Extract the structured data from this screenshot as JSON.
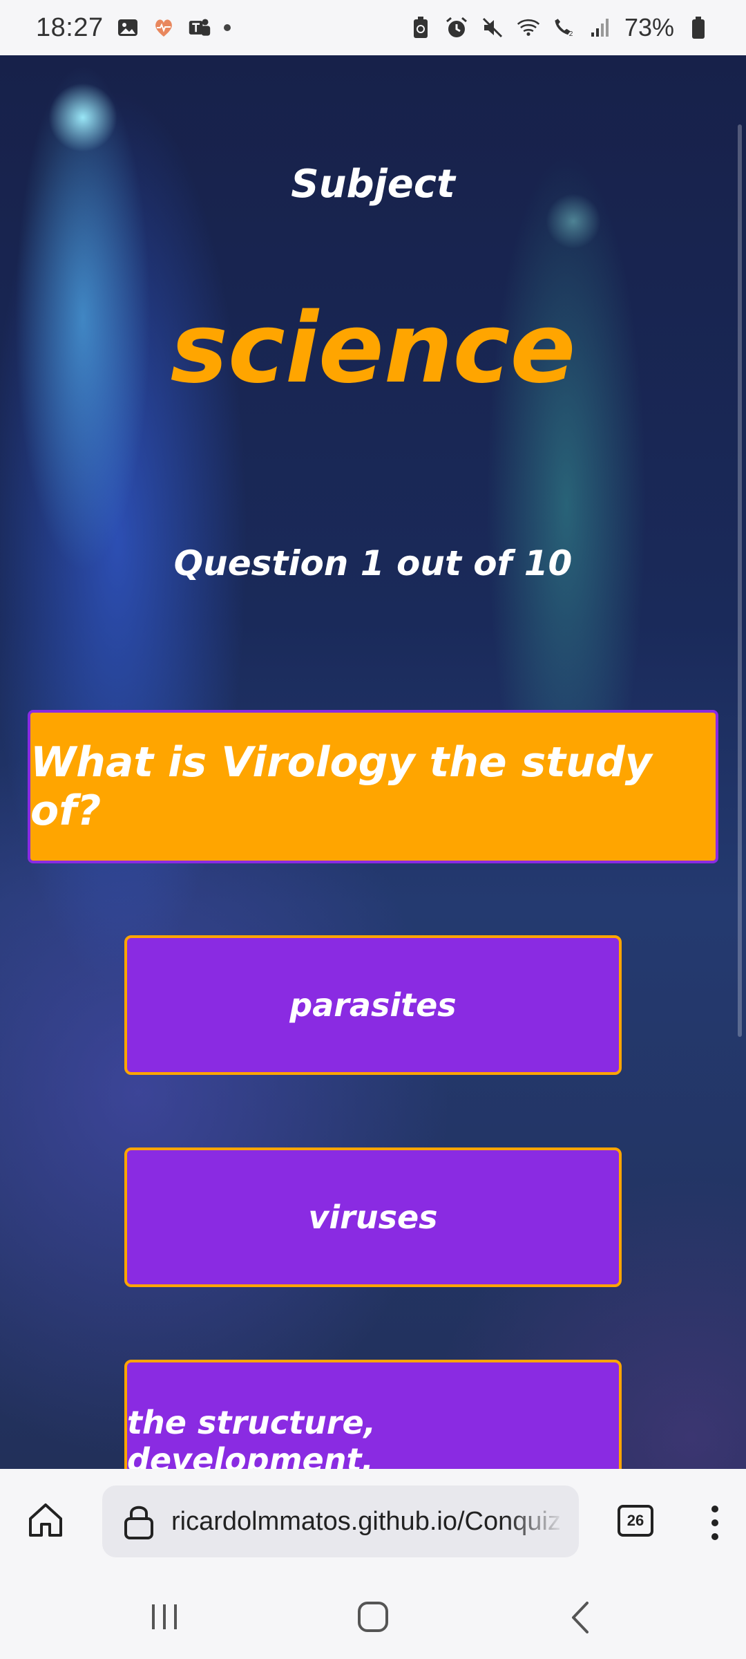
{
  "status_bar": {
    "time": "18:27",
    "battery": "73%"
  },
  "quiz": {
    "subject_label": "Subject",
    "subject_value": "science",
    "question_counter": "Question 1 out of 10",
    "question": "What is Virology the study of?",
    "answers": [
      "parasites",
      "viruses",
      "the structure, development,"
    ]
  },
  "browser": {
    "url": "ricardolmmatos.github.io/Conquiz",
    "tab_count": "26"
  },
  "colors": {
    "accent_orange": "#ffa500",
    "accent_purple": "#8a2be2"
  }
}
